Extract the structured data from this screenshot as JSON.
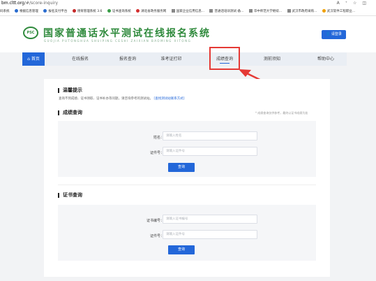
{
  "browser": {
    "url_host": "bm.cltt.org",
    "url_path": "/#/score-inquiry",
    "bookmarks": [
      "码系统",
      "根据信息管理",
      "报名支付平台",
      "德育管理系统 3.6",
      "证书查询系统",
      "湖北省政务服务网",
      "国家企业信用信息...",
      "普通话培训测试-备...",
      "华中师范大学继续...",
      "武汉市政府采购...",
      "武汉软件工程职业..."
    ]
  },
  "header": {
    "logo_text": "PSC",
    "title": "国家普通话水平测试在线报名系统",
    "subtitle": "GUOJIA PUTONGHUA SHUIPING CESHI ZAIXIAN BAOMING XITONG",
    "login_label": "请登录"
  },
  "nav": {
    "items": [
      "首页",
      "在线报名",
      "报名查询",
      "准考证打印",
      "成绩查询",
      "测前须知",
      "帮助中心"
    ],
    "active": "成绩查询"
  },
  "tips": {
    "title": "温馨提示",
    "text": "查询不到成绩、证书领取、证书补办等问题，请咨询参考的测试站。",
    "link": "[查找测试站联系方式]"
  },
  "score_query": {
    "title": "成绩查询",
    "note": "* 成绩查询仅供参考，最终以证书成绩为准",
    "name_label": "姓名：",
    "name_placeholder": "请输入姓名",
    "id_label": "证件号：",
    "id_placeholder": "请输入证件号",
    "button": "查询"
  },
  "cert_query": {
    "title": "证书查询",
    "cert_no_label": "证书编号：",
    "cert_no_placeholder": "请输入证书编号",
    "id_label": "证件号：",
    "id_placeholder": "请输入证件号",
    "button": "查询"
  },
  "colors": {
    "brand_green": "#2f8a3c",
    "accent_blue": "#2367d9",
    "annotation_red": "#e53935"
  }
}
